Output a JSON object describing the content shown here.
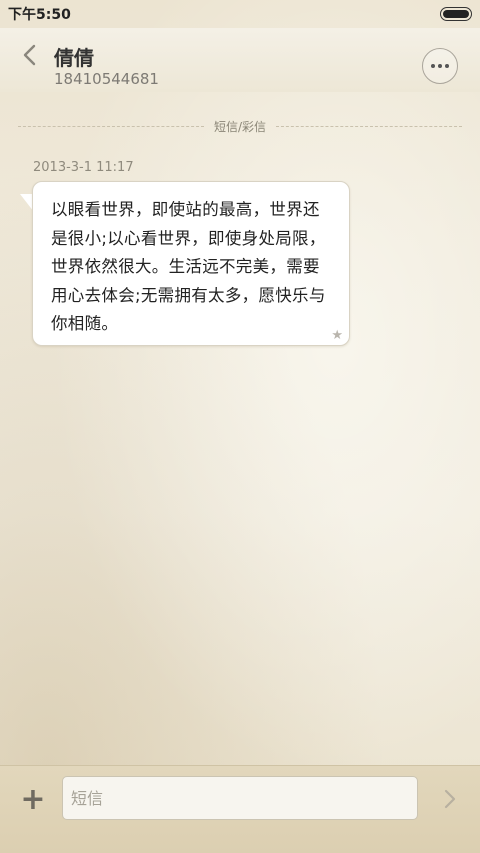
{
  "status_bar": {
    "time": "下午5:50"
  },
  "header": {
    "contact_name": "倩倩",
    "contact_number": "18410544681"
  },
  "conversation": {
    "divider_label": "短信/彩信",
    "messages": [
      {
        "timestamp": "2013-3-1 11:17",
        "text": "以眼看世界，即使站的最高，世界还是很小;以心看世界，即使身处局限，世界依然很大。生活远不完美，需要用心去体会;无需拥有太多，愿快乐与你相随。",
        "starred": true,
        "star_glyph": "★"
      }
    ]
  },
  "compose": {
    "placeholder": "短信",
    "value": "",
    "plus_glyph": "+"
  },
  "colors": {
    "paper": "#efe9d9",
    "bubble": "#ffffff",
    "text": "#222222"
  }
}
